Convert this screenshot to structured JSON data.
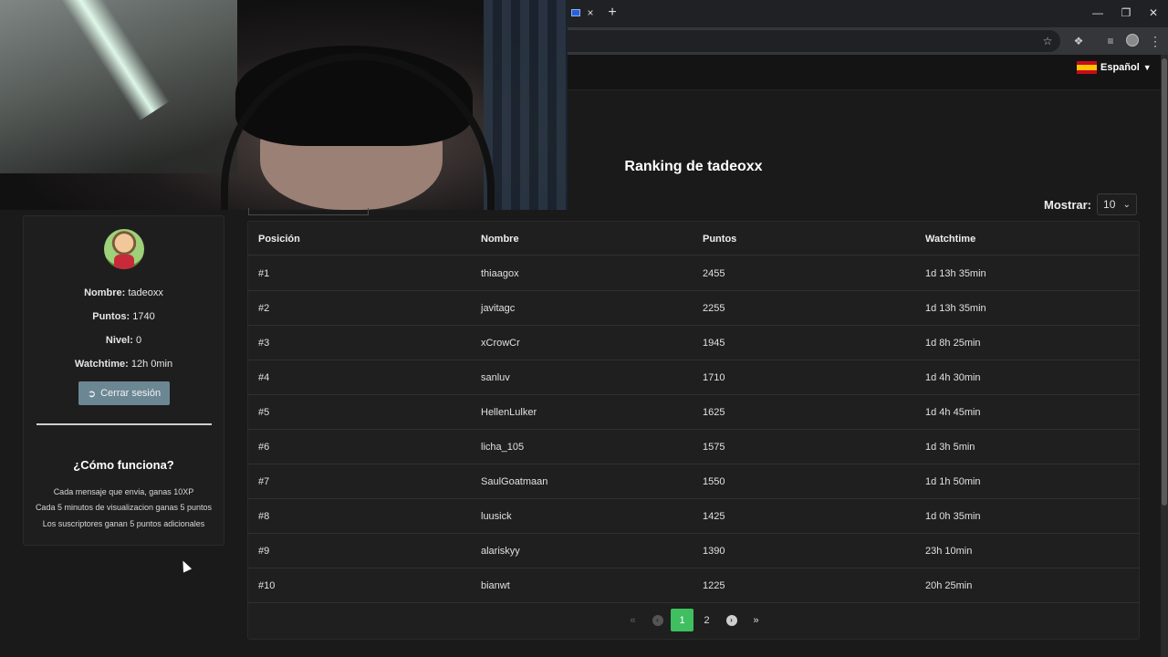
{
  "browser": {
    "new_tab_glyph": "+",
    "close_glyph": "×"
  },
  "nav": {
    "language": "Español",
    "flag_icon": "spain-flag-icon"
  },
  "page": {
    "title": "Ranking de tadeoxx",
    "show_label": "Mostrar:",
    "show_value": "10"
  },
  "profile": {
    "name_label": "Nombre:",
    "name_value": "tadeoxx",
    "points_label": "Puntos:",
    "points_value": "1740",
    "level_label": "Nivel:",
    "level_value": "0",
    "watchtime_label": "Watchtime:",
    "watchtime_value": "12h 0min",
    "logout_label": "Cerrar sesión"
  },
  "how": {
    "title": "¿Cómo funciona?",
    "rules": [
      "Cada mensaje que envia, ganas 10XP",
      "Cada 5 minutos de visualizacion ganas 5 puntos",
      "Los suscriptores ganan 5 puntos adicionales"
    ]
  },
  "table": {
    "headers": [
      "Posición",
      "Nombre",
      "Puntos",
      "Watchtime"
    ],
    "rows": [
      [
        "#1",
        "thiaagox",
        "2455",
        "1d 13h 35min"
      ],
      [
        "#2",
        "javitagc",
        "2255",
        "1d 13h 35min"
      ],
      [
        "#3",
        "xCrowCr",
        "1945",
        "1d 8h 25min"
      ],
      [
        "#4",
        "sanluv",
        "1710",
        "1d 4h 30min"
      ],
      [
        "#5",
        "HellenLulker",
        "1625",
        "1d 4h 45min"
      ],
      [
        "#6",
        "licha_105",
        "1575",
        "1d 3h 5min"
      ],
      [
        "#7",
        "SaulGoatmaan",
        "1550",
        "1d 1h 50min"
      ],
      [
        "#8",
        "luusick",
        "1425",
        "1d 0h 35min"
      ],
      [
        "#9",
        "alariskyy",
        "1390",
        "23h 10min"
      ],
      [
        "#10",
        "bianwt",
        "1225",
        "20h 25min"
      ]
    ]
  },
  "pagination": {
    "first": "«",
    "prev": "‹",
    "pages": [
      "1",
      "2"
    ],
    "current": "1",
    "next": "›",
    "last": "»"
  },
  "colors": {
    "accent_green": "#3fbf5f",
    "logout_button": "#6c8794",
    "background": "#1a1a1a"
  }
}
